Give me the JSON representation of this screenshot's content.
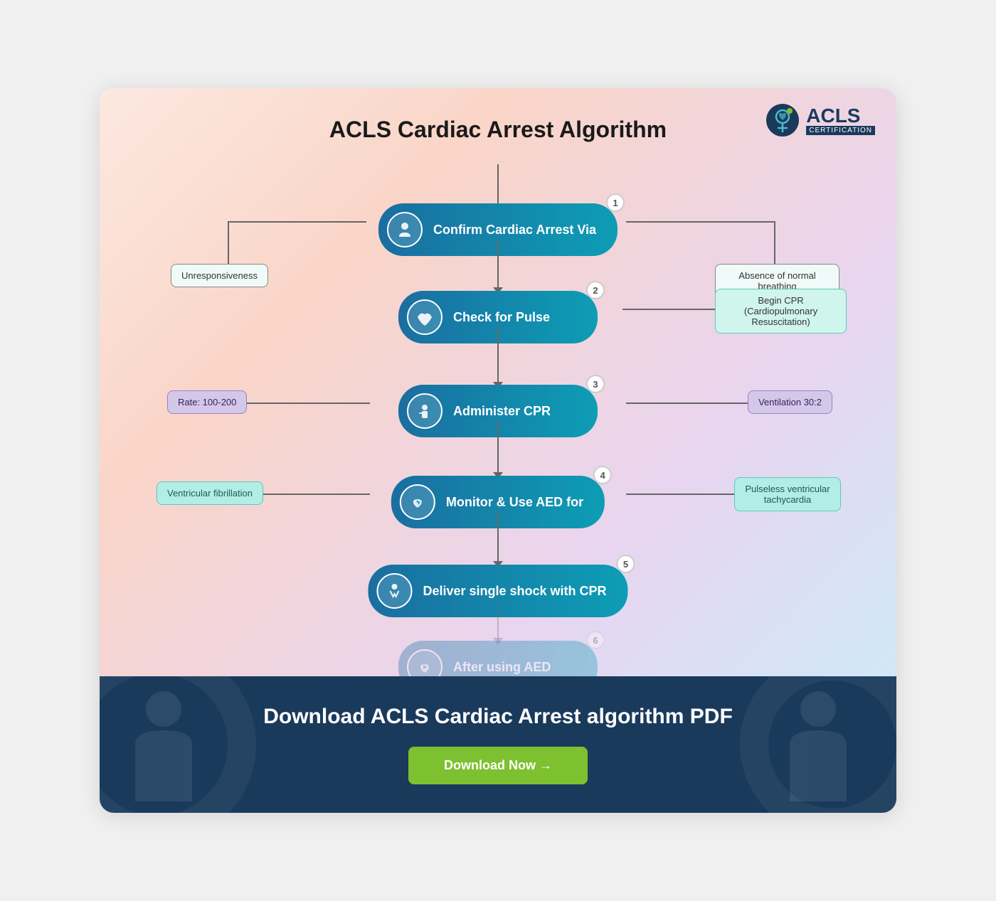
{
  "page": {
    "title": "ACLS Cardiac Arrest Algorithm",
    "logo": {
      "acls": "ACLS",
      "cert": "CERTIFICATION"
    },
    "download": {
      "title": "Download ACLS Cardiac Arrest algorithm PDF",
      "button_label": "Download Now →"
    },
    "steps": [
      {
        "number": "1",
        "label": "Confirm Cardiac Arrest Via",
        "icon": "🫁"
      },
      {
        "number": "2",
        "label": "Check for Pulse",
        "icon": "✋"
      },
      {
        "number": "3",
        "label": "Administer CPR",
        "icon": "🫀"
      },
      {
        "number": "4",
        "label": "Monitor & Use AED for",
        "icon": "⚡"
      },
      {
        "number": "5",
        "label": "Deliver single shock with CPR",
        "icon": "🧑‍⚕️"
      },
      {
        "number": "6",
        "label": "After using AED",
        "icon": "⚡"
      }
    ],
    "side_nodes": {
      "step1_left": "Unresponsiveness",
      "step1_right": "Absence of normal breathing",
      "step2_right": "Begin CPR\n(Cardiopulmonary Resuscitation)",
      "step3_left": "Rate: 100-200",
      "step3_right": "Ventilation 30:2",
      "step4_left": "Ventricular fibrillation",
      "step4_right": "Pulseless ventricular\ntachycardia"
    }
  }
}
